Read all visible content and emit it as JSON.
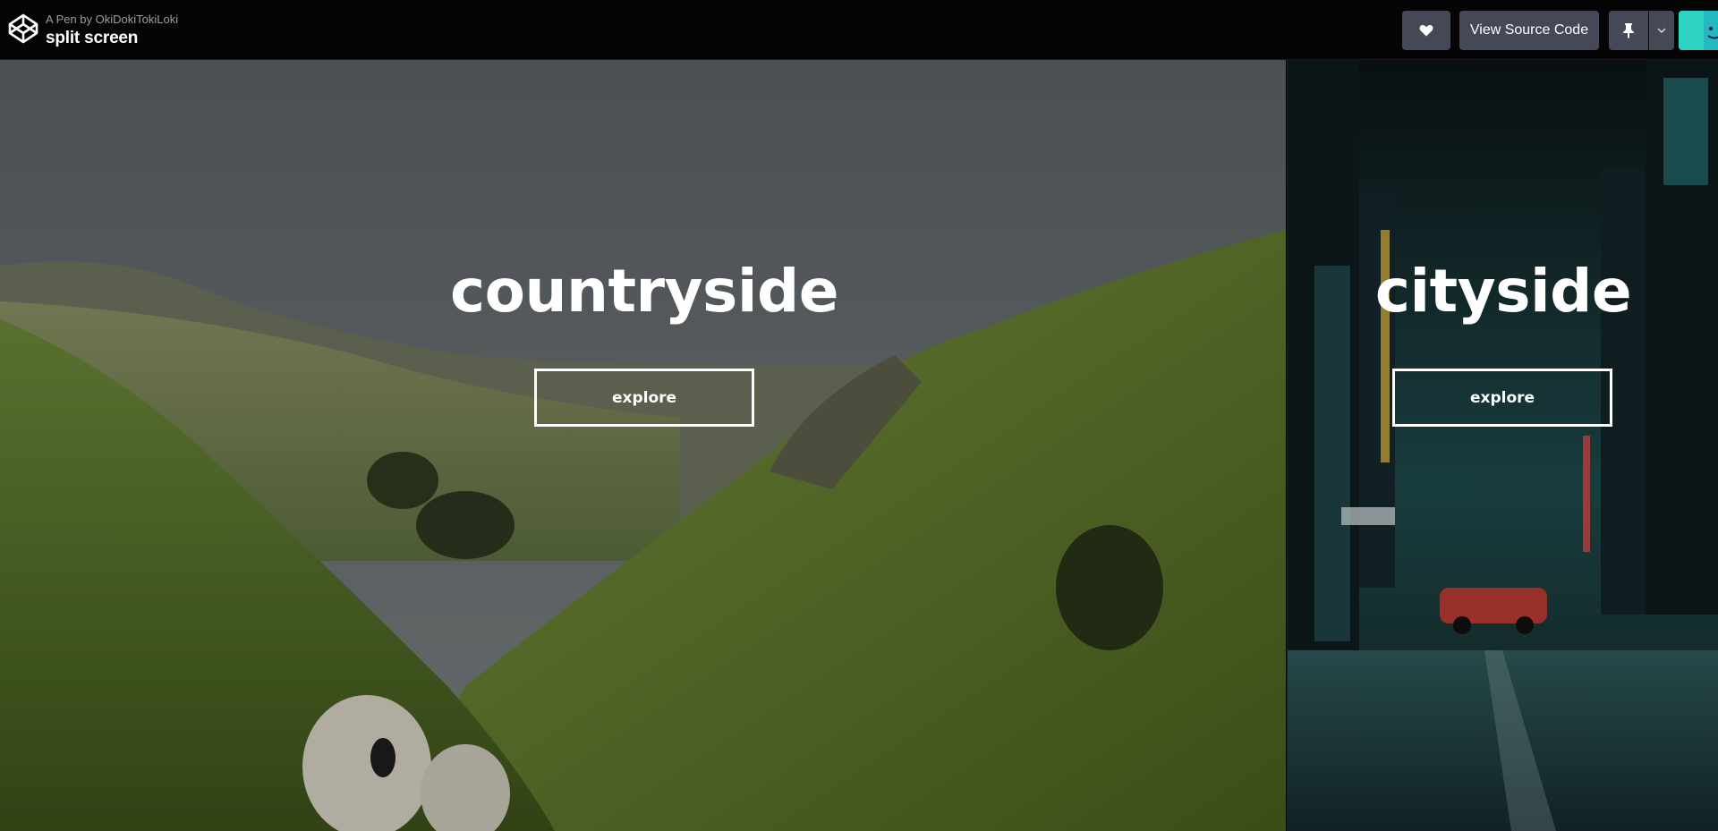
{
  "header": {
    "pen_by": "A Pen by OkiDokiTokiLoki",
    "title": "split screen",
    "view_source_label": "View Source Code"
  },
  "panels": {
    "left": {
      "heading": "countryside",
      "button_label": "explore"
    },
    "right": {
      "heading": "cityside",
      "button_label": "explore"
    }
  },
  "icons": {
    "logo": "codepen-logo-icon",
    "like": "heart-icon",
    "pin": "pin-icon",
    "caret": "chevron-down-icon"
  },
  "colors": {
    "topbar_bg": "#050505",
    "button_bg": "#444857",
    "avatar_accent": "#3fe0c8"
  }
}
